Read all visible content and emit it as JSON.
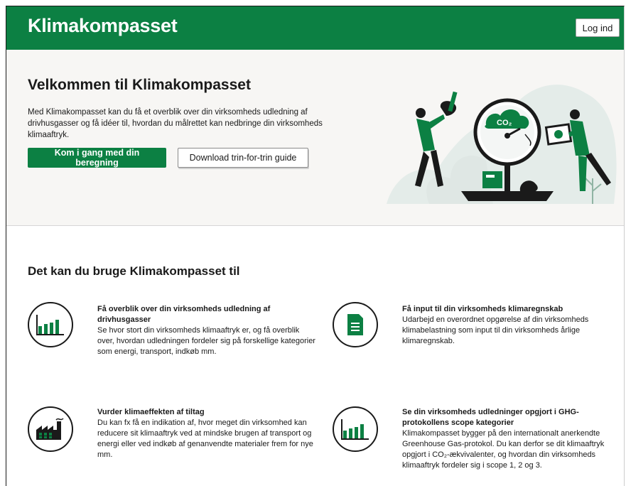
{
  "header": {
    "brand": "Klimakompasset",
    "login_label": "Log ind"
  },
  "hero": {
    "title": "Velkommen til Klimakompasset",
    "text": "Med Klimakompasset kan du få et overblik over din virksomheds udledning af drivhusgasser og få idéer til, hvordan du målrettet kan nedbringe din virksomheds klimaaftryk.",
    "primary_button": "Kom i gang med din beregning",
    "secondary_button": "Download trin-for-trin guide",
    "illustration_badge": "CO₂"
  },
  "section": {
    "title": "Det kan du bruge Klimakompasset til"
  },
  "features": [
    {
      "icon": "bar-chart-icon",
      "title": "Få overblik over din virksomheds udledning af drivhusgasser",
      "text": "Se hvor stort din virksomheds klimaaftryk er, og få overblik over, hvordan udledningen fordeler sig på forskellige kategorier som energi, transport, indkøb mm."
    },
    {
      "icon": "document-icon",
      "title": "Få input til din virksomheds klimaregnskab",
      "text": "Udarbejd en overordnet opgørelse af din virksomheds klimabelastning som input til din virksomheds årlige klimaregnskab."
    },
    {
      "icon": "factory-icon",
      "title": "Vurder klimaeffekten af tiltag",
      "text": "Du kan fx få en indikation af, hvor meget din virksomhed kan reducere sit klimaaftryk ved at mindske brugen af transport og energi eller ved indkøb af genanvendte materialer frem for nye mm."
    },
    {
      "icon": "bar-chart-icon",
      "title": "Se din virksomheds udledninger opgjort i GHG-protokollens scope kategorier",
      "text": "Klimakompasset bygger på den internationalt anerkendte Greenhouse Gas-protokol. Du kan derfor se dit klimaaftryk opgjort i CO₂-ækvivalenter, og hvordan din virksomheds klimaaftryk fordeler sig i scope 1, 2 og 3."
    }
  ],
  "colors": {
    "brand_green": "#0c8043",
    "hero_background": "#f7f6f4"
  }
}
